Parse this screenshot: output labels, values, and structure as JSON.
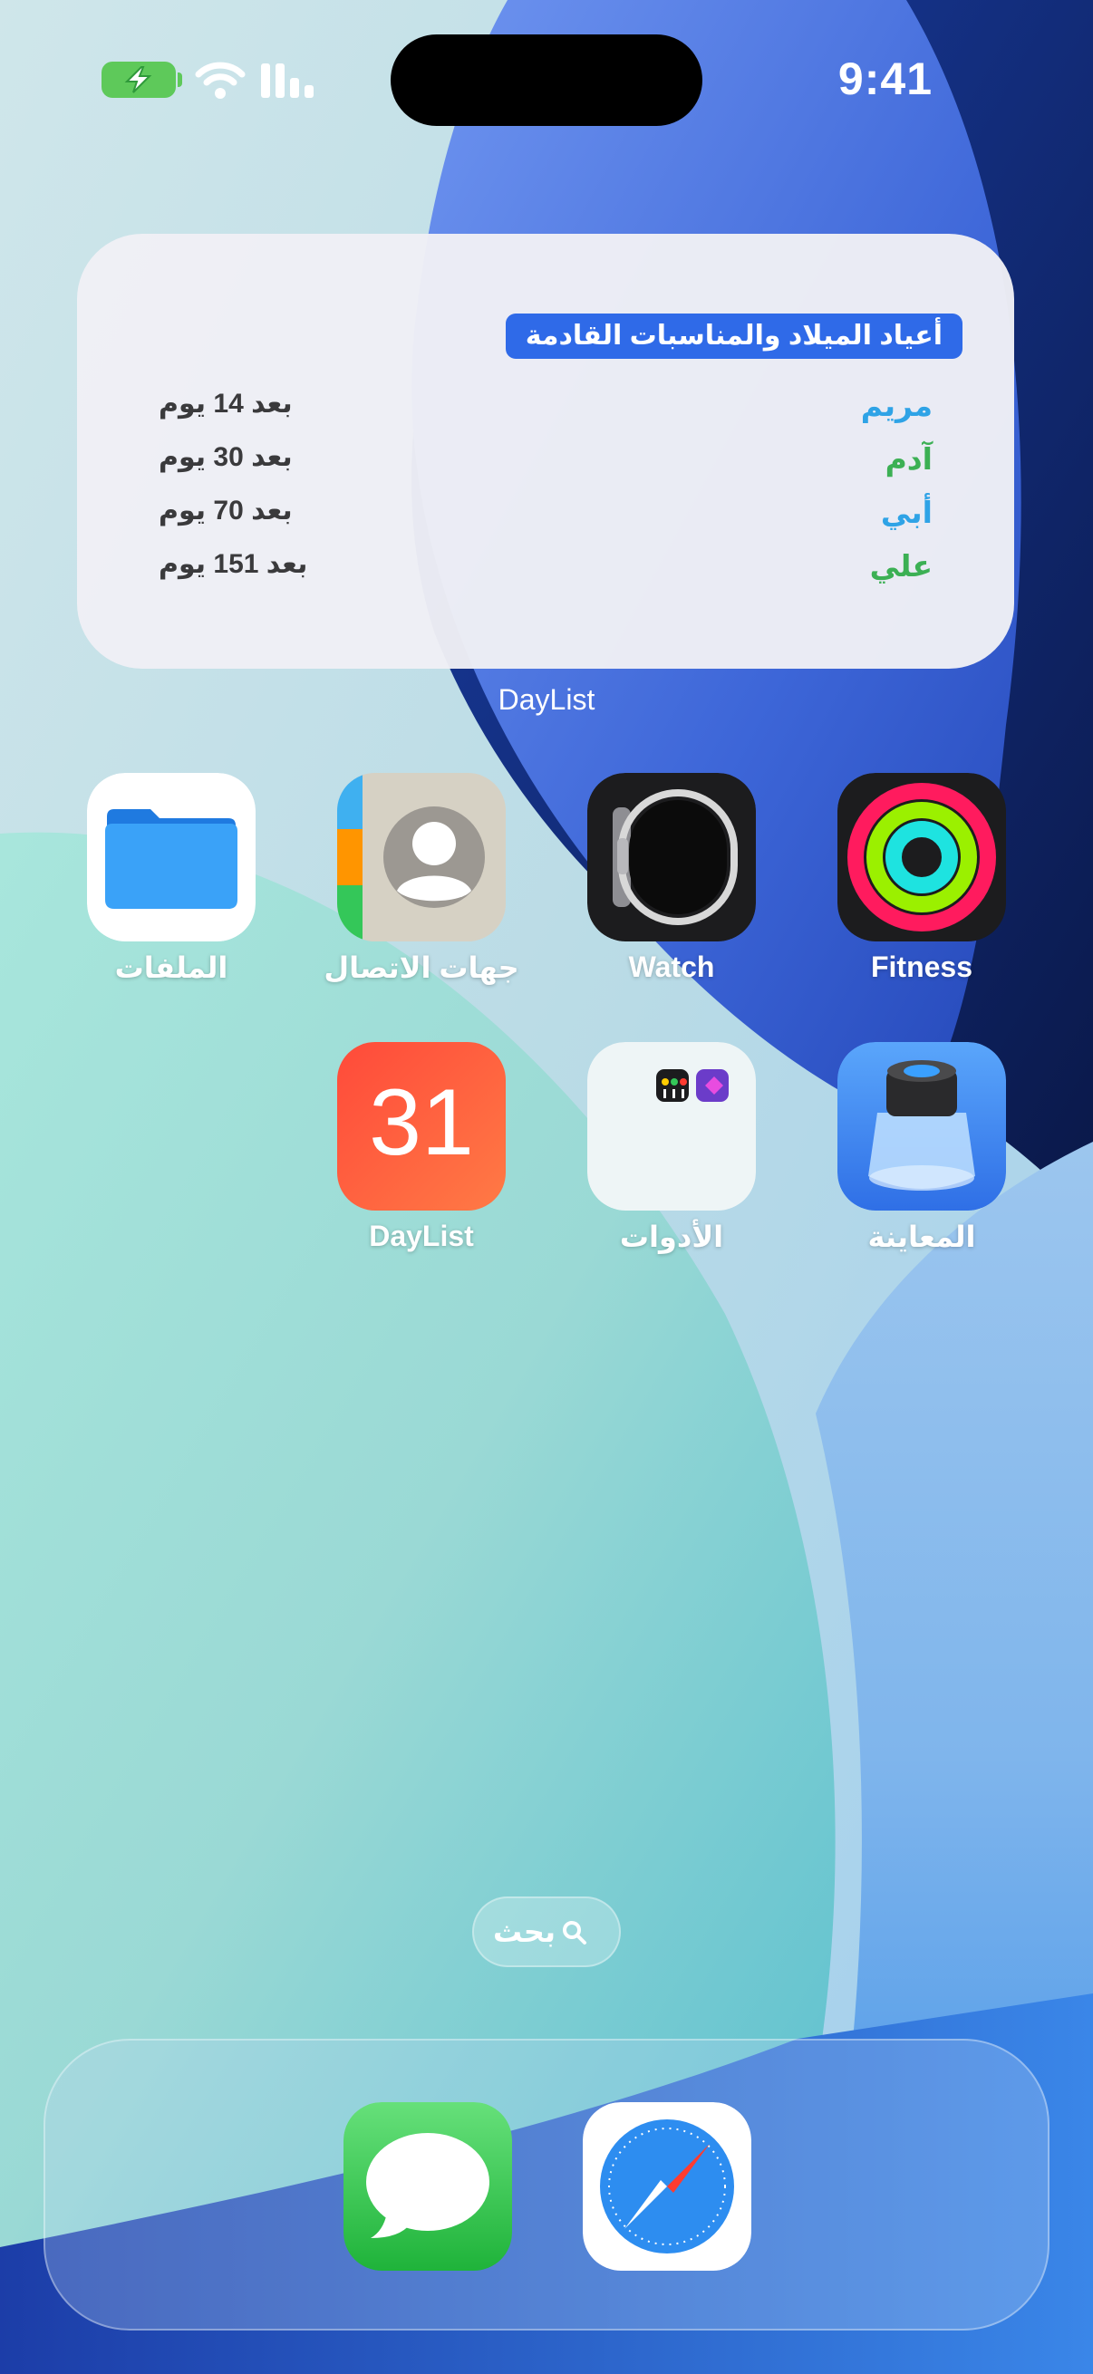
{
  "status_bar": {
    "time": "9:41",
    "battery_state": "charging",
    "wifi": "full",
    "signal": "bars"
  },
  "widget": {
    "title": "أعياد الميلاد والمناسبات القادمة",
    "rows": [
      {
        "name": "مريم",
        "when": "بعد 14 يوم",
        "color": "#2fa3e6"
      },
      {
        "name": "آدم",
        "when": "بعد 30 يوم",
        "color": "#3cb054"
      },
      {
        "name": "أبي",
        "when": "بعد 70 يوم",
        "color": "#2fa3e6"
      },
      {
        "name": "علي",
        "when": "بعد 151 يوم",
        "color": "#3cb054"
      }
    ],
    "app_label": "DayList"
  },
  "apps": [
    {
      "label": "Fitness",
      "icon": "activity-rings-icon"
    },
    {
      "label": "Watch",
      "icon": "apple-watch-icon"
    },
    {
      "label": "جهات الاتصال",
      "icon": "contacts-icon"
    },
    {
      "label": "الملفات",
      "icon": "folder-icon"
    },
    {
      "label": "المعاينة",
      "icon": "preview-loupe-icon"
    },
    {
      "label": "الأدوات",
      "icon": "utilities-folder-icon"
    },
    {
      "label": "DayList",
      "icon": "calendar-day-icon",
      "day_number": "31"
    }
  ],
  "search": {
    "label": "بحث"
  },
  "dock": [
    {
      "name": "messages",
      "icon": "messages-icon"
    },
    {
      "name": "safari",
      "icon": "safari-compass-icon"
    }
  ],
  "colors": {
    "accent": "#2f6ae8",
    "teal": "#9fe0d4",
    "blue": "#3e68d8",
    "navy": "#0e1f5a"
  }
}
